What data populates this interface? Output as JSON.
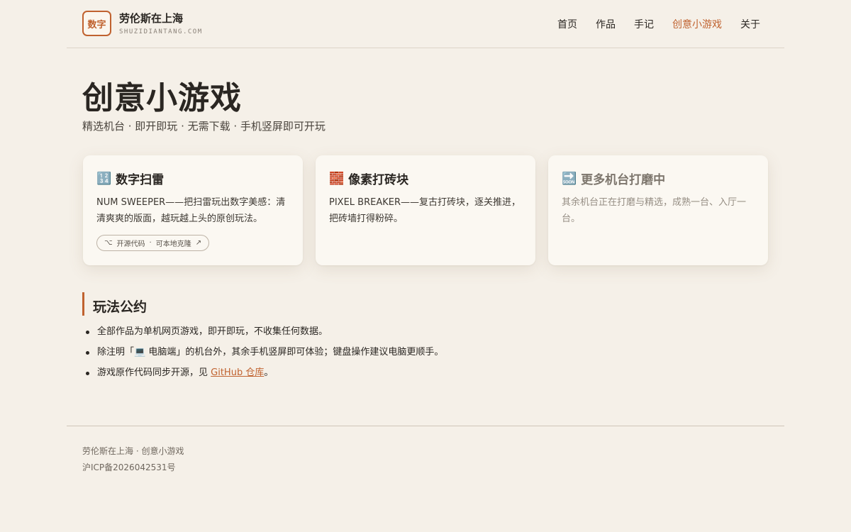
{
  "site": {
    "logo_text": "数字",
    "name": "劳伦斯在上海",
    "domain": "SHUZIDIANTANG.COM"
  },
  "nav": {
    "items": [
      "首页",
      "作品",
      "手记",
      "创意小游戏",
      "关于"
    ],
    "active_index": 3
  },
  "page": {
    "title": "创意小游戏",
    "subtitle": "精选机台 · 即开即玩 · 无需下载 · 手机竖屏即可开玩"
  },
  "cards": [
    {
      "icon": "🔢",
      "title": "数字扫雷",
      "desc": "NUM SWEEPER——把扫雷玩出数字美感：清清爽爽的版面，越玩越上头的原创玩法。",
      "pill": {
        "icon": "⌥",
        "label": "开源代码",
        "sep": "·",
        "label2": "可本地克隆",
        "arrow": "↗"
      }
    },
    {
      "icon": "🧱",
      "title": "像素打砖块",
      "desc": "PIXEL BREAKER——复古打砖块，逐关推进，把砖墙打得粉碎。"
    },
    {
      "icon": "🔜",
      "title": "更多机台打磨中",
      "desc": "其余机台正在打磨与精选，成熟一台、入厅一台。"
    }
  ],
  "rules": {
    "title": "玩法公约",
    "items": [
      "全部作品为单机网页游戏，即开即玩，不收集任何数据。",
      "除注明「💻 电脑端」的机台外，其余手机竖屏即可体验；键盘操作建议电脑更顺手。"
    ],
    "last_prefix": "游戏原作代码同步开源，见 ",
    "last_link": "GitHub 仓库",
    "last_suffix": "。"
  },
  "footer": {
    "line1": "劳伦斯在上海 · 创意小游戏",
    "line2": "沪ICP备2026042531号"
  },
  "colors": {
    "accent": "#c0622f",
    "background": "#f5f0e8",
    "card": "#fbf8f2"
  }
}
